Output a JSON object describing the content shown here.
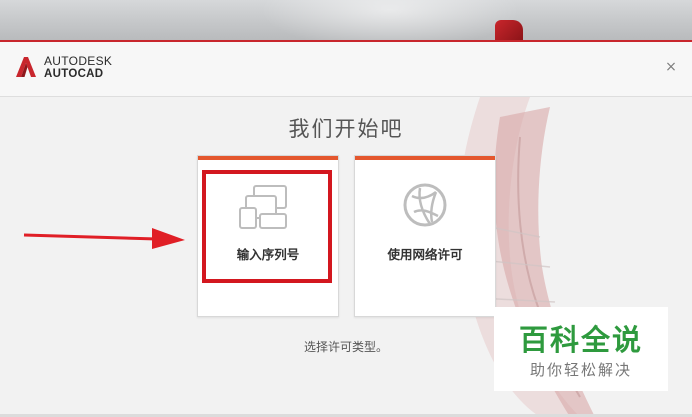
{
  "window": {
    "brand_line1": "AUTODESK",
    "brand_line2": "AUTOCAD",
    "close_glyph": "×"
  },
  "main": {
    "heading": "我们开始吧",
    "options": [
      {
        "label": "输入序列号",
        "icon": "devices-icon",
        "selected": true
      },
      {
        "label": "使用网络许可",
        "icon": "globe-network-icon",
        "selected": false
      }
    ],
    "hint": "选择许可类型。"
  },
  "watermark": {
    "line1": "百科全说",
    "line2": "助你轻松解决"
  },
  "colors": {
    "accent_red": "#c8262d",
    "card_stripe": "#e4572e",
    "highlight_box": "#d3171f",
    "watermark_green": "#2e9a3e"
  }
}
